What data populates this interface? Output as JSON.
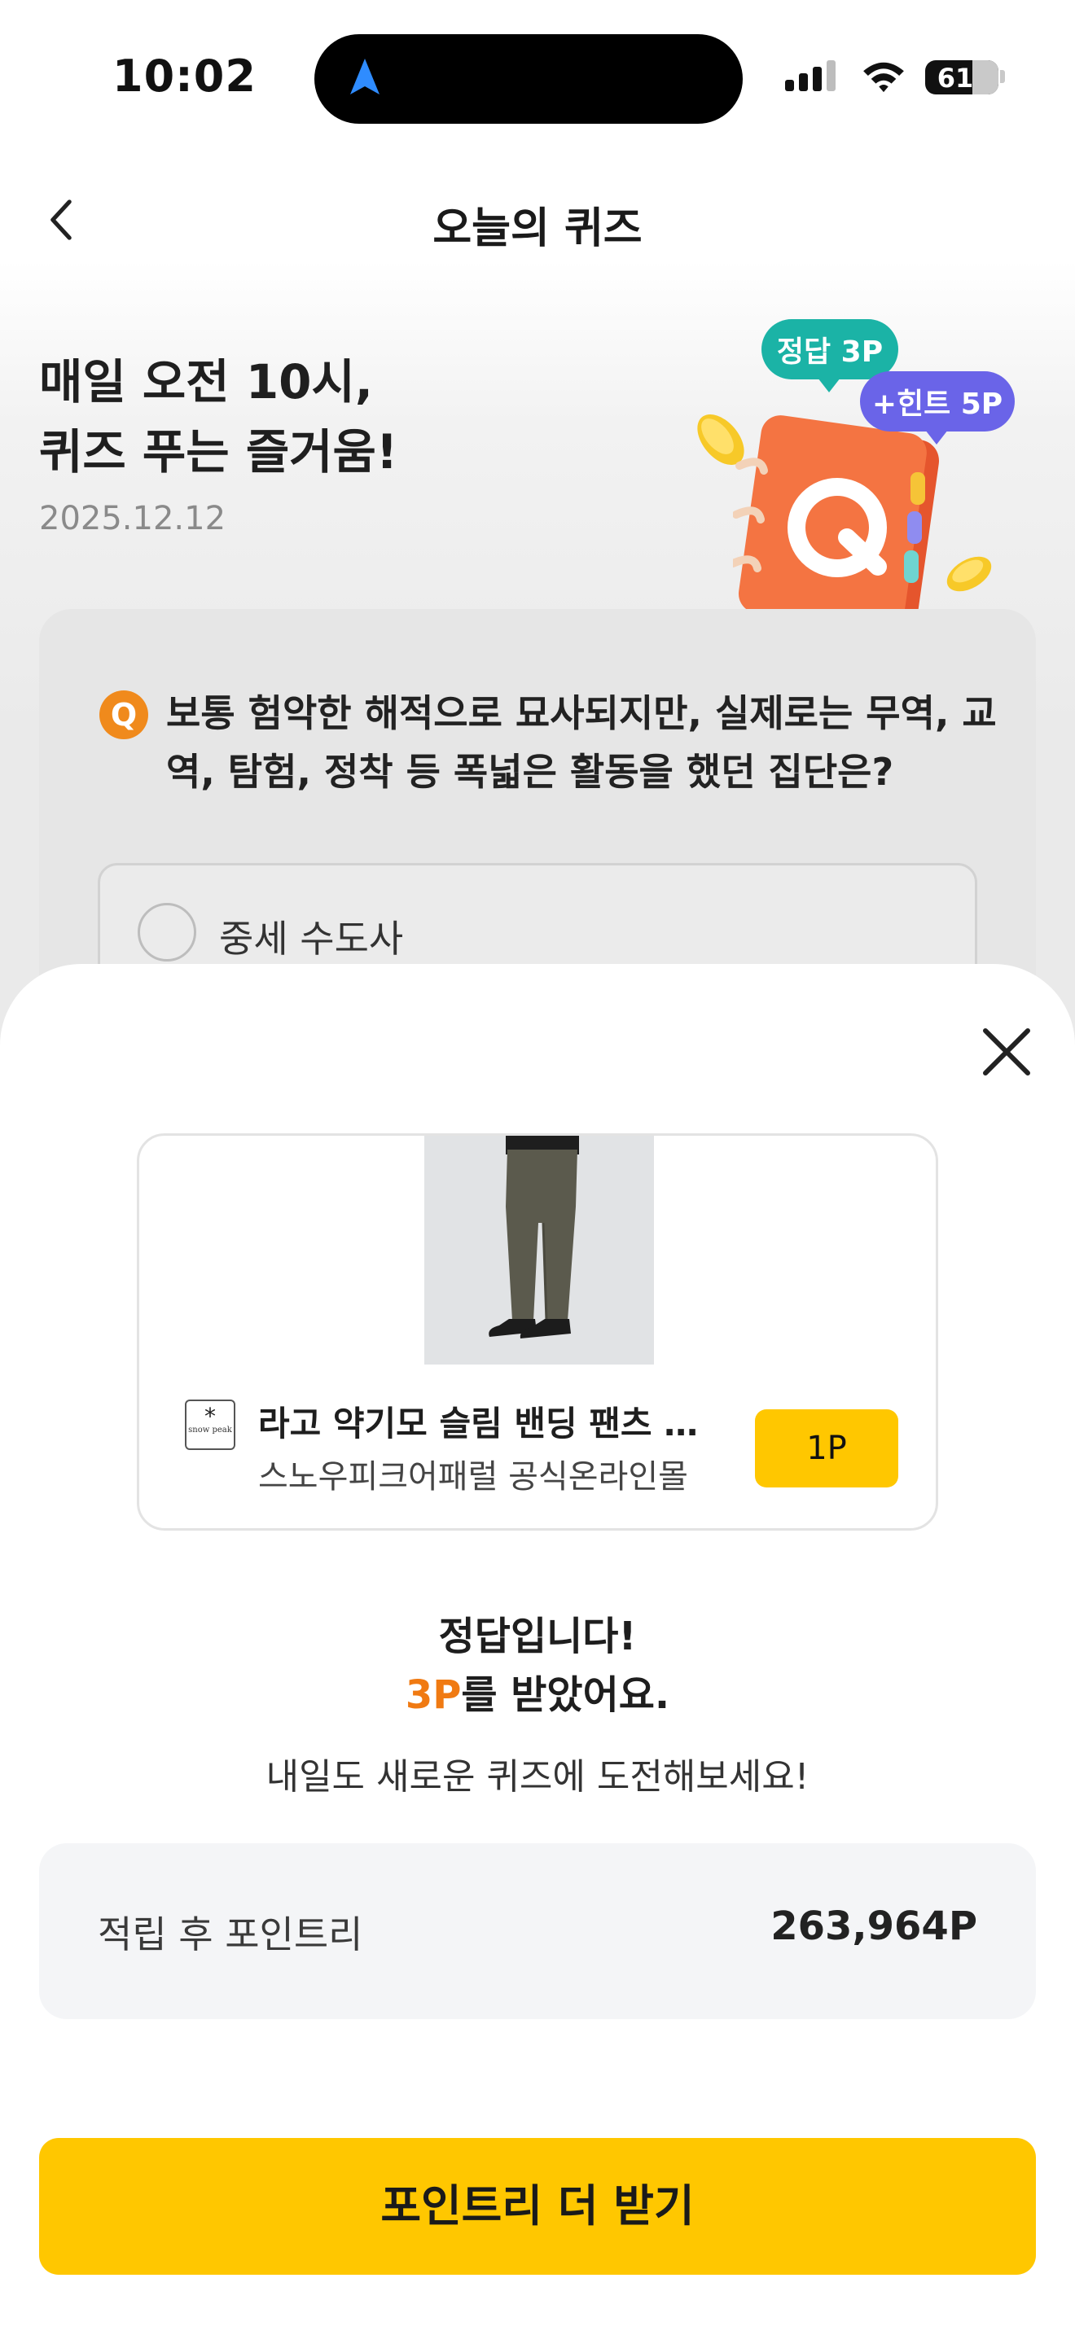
{
  "status_bar": {
    "time": "10:02",
    "battery": "61",
    "signal_icon": "cellular-signal-icon",
    "wifi_icon": "wifi-icon",
    "location_icon": "location-arrow-icon"
  },
  "header": {
    "title": "오늘의 퀴즈",
    "back_icon": "chevron-left-icon"
  },
  "hero": {
    "title_line1": "매일 오전 10시,",
    "title_line2": "퀴즈 푸는 즐거움!",
    "date": "2025.12.12",
    "bubble_answer": "정답 3P",
    "bubble_hint": "+힌트 5P",
    "notebook_letter": "Q",
    "colors": {
      "answer_bubble": "#1bb3a6",
      "hint_bubble": "#6a64e8",
      "notebook": "#f26a3d",
      "coin": "#f7c928"
    }
  },
  "quiz": {
    "badge": "Q",
    "question": "보통 험악한 해적으로 묘사되지만, 실제로는 무역, 교역, 탐험, 정착 등 폭넓은 활동을 했던 집단은?",
    "options": [
      {
        "label": "중세 수도사"
      }
    ]
  },
  "sheet": {
    "close_icon": "close-icon",
    "product": {
      "name": "라고 약기모 슬림 밴딩 팬츠 Dar...",
      "store": "스노우피크어패럴 공식온라인몰",
      "brand_logo_text": "snow peak",
      "point_button": "1P",
      "image_icon": "pants-product-image"
    },
    "result": {
      "title": "정답입니다!",
      "points_highlight": "3P",
      "points_suffix": "를 받았어요.",
      "subtitle": "내일도 새로운 퀴즈에 도전해보세요!"
    },
    "balance": {
      "label": "적립 후 포인트리",
      "value": "263,964P"
    },
    "cta": "포인트리 더 받기",
    "colors": {
      "accent": "#f07a12",
      "cta": "#ffc700"
    }
  }
}
